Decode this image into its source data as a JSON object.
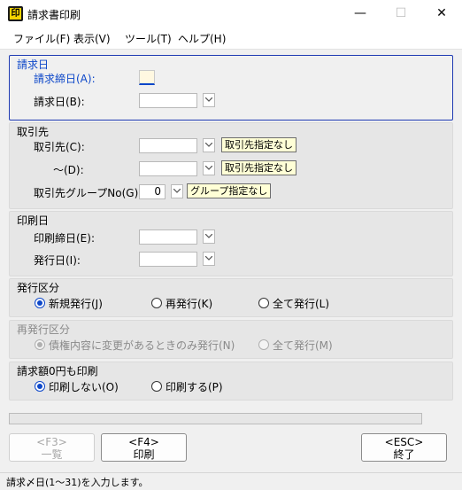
{
  "window": {
    "title": "請求書印刷",
    "icon_label": "印",
    "minimize": "—",
    "maximize": "☐",
    "close": "✕"
  },
  "menu": [
    "ファイル(F)",
    "表示(V)",
    "ツール(T)",
    "ヘルプ(H)"
  ],
  "billing_date": {
    "group_label": "請求日",
    "cutoff_label": "請求締日(A):",
    "cutoff_value": "",
    "date_label": "請求日(B):",
    "date_value": ""
  },
  "customer": {
    "group_label": "取引先",
    "from_label": "取引先(C):",
    "from_value": "",
    "from_tag": "取引先指定なし",
    "to_label": "～(D):",
    "to_value": "",
    "to_tag": "取引先指定なし",
    "group_no_label": "取引先グループNo(G):",
    "group_no_value": "0",
    "group_tag": "グループ指定なし"
  },
  "print_date": {
    "group_label": "印刷日",
    "cutoff_label": "印刷締日(E):",
    "cutoff_value": "",
    "issue_label": "発行日(I):",
    "issue_value": ""
  },
  "issue_type": {
    "group_label": "発行区分",
    "options": [
      "新規発行(J)",
      "再発行(K)",
      "全て発行(L)"
    ],
    "selected": 0
  },
  "reissue_type": {
    "group_label": "再発行区分",
    "options": [
      "債権内容に変更があるときのみ発行(N)",
      "全て発行(M)"
    ],
    "selected": 0
  },
  "zero_print": {
    "group_label": "請求額0円も印刷",
    "options": [
      "印刷しない(O)",
      "印刷する(P)"
    ],
    "selected": 0
  },
  "progress": 0,
  "buttons": {
    "list": {
      "key": "<F3>",
      "label": "一覧"
    },
    "print": {
      "key": "<F4>",
      "label": "印刷"
    },
    "exit": {
      "key": "<ESC>",
      "label": "終了"
    }
  },
  "status_text": "請求〆日(1～31)を入力します。",
  "colors": {
    "accent": "#0d47c9",
    "tag_bg": "#ffffd6",
    "focus_bg": "#fff8e1"
  }
}
